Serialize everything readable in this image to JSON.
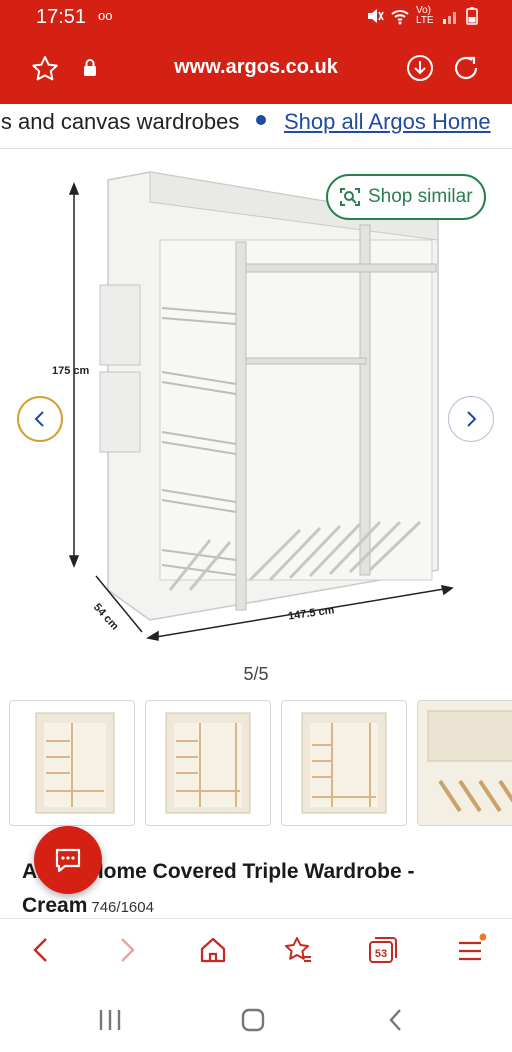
{
  "status_bar": {
    "time": "17:51",
    "voicemail": "oo",
    "network": "Vo) LTE"
  },
  "browser": {
    "url": "www.argos.co.uk"
  },
  "breadcrumb": {
    "current": "ls and canvas wardrobes",
    "link": "Shop all Argos Home"
  },
  "gallery": {
    "shop_similar_label": "Shop similar",
    "dimensions": {
      "height": "175 cm",
      "depth": "54 cm",
      "width": "147.5 cm"
    },
    "counter": "5/5"
  },
  "product": {
    "title_line1": "Argos Home Covered Triple Wardrobe -",
    "title_line2": "Cream",
    "sku": "746/1604"
  },
  "toolbar": {
    "tabs_count": "53"
  },
  "colors": {
    "brand": "#d42114",
    "link": "#1f4c9f",
    "shop_similar": "#2a7f4e",
    "prev_ring": "#d1a02f"
  }
}
